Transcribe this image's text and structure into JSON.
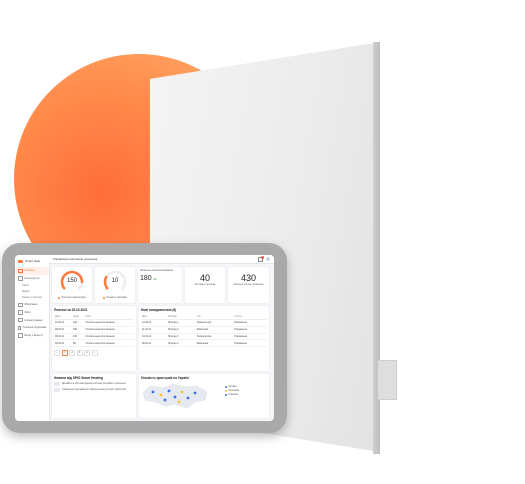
{
  "app": {
    "logo": "Smart Heat",
    "title": "Управління системою опалення"
  },
  "sidebar": {
    "items": [
      {
        "label": "Головна",
        "active": true
      },
      {
        "label": "Конструктор",
        "active": false
      },
      {
        "label": "Зберігання",
        "active": false
      },
      {
        "label": "Звіти",
        "active": false
      },
      {
        "label": "Налаштування",
        "active": false
      },
      {
        "label": "Технічна підтримка",
        "active": false
      },
      {
        "label": "Вихід з акаунту",
        "active": false
      }
    ],
    "subitems": [
      "Офіси",
      "Будівлі",
      "Кімнати і пристрої"
    ]
  },
  "header": {
    "notifications": "1"
  },
  "stats": {
    "gauge1": {
      "value": "150",
      "label": "Поточна температура",
      "color": "#ff7a3c"
    },
    "gauge2": {
      "value": "10",
      "label": "Кількість приладів",
      "color": "#ff7a3c"
    },
    "energy": {
      "label": "Загальне енергоспоживання",
      "value": "180",
      "unit": "кВт"
    },
    "count1": {
      "value": "40",
      "label": "Активних приладів"
    },
    "count2": {
      "value": "430",
      "label": "Загальна площа приміщень"
    }
  },
  "payments": {
    "title": "Платежі за 25.02.2021",
    "columns": [
      "Дата",
      "Сума",
      "Опис"
    ],
    "rows": [
      [
        "10.02.21",
        "120",
        "Оплата енергопостачання"
      ],
      [
        "09.02.21",
        "340",
        "Оплата енергопостачання"
      ],
      [
        "06.02.21",
        "210",
        "Оплата енергопостачання"
      ],
      [
        "03.02.21",
        "98",
        "Оплата енергопостачання"
      ]
    ],
    "pages": [
      "1",
      "2",
      "3",
      "4"
    ]
  },
  "notifications": {
    "title": "Нові повідомлення (6)",
    "columns": [
      "Дата",
      "Прилад",
      "Тип",
      "Статус"
    ],
    "rows": [
      [
        "12.02.21",
        "Прилад 1",
        "Температура",
        "Нормально"
      ],
      [
        "11.02.21",
        "Прилад 2",
        "Живлення",
        "Нормально"
      ],
      [
        "10.02.21",
        "Прилад 3",
        "Температура",
        "Нормально"
      ],
      [
        "08.02.21",
        "Прилад 4",
        "Живлення",
        "Нормально"
      ]
    ]
  },
  "news": {
    "title": "Новини від SPIO Smart Heating",
    "items": [
      "Дізнайтесь про нові функції системи розумного опалення",
      "Оновлення програмного забезпечення для всіх пристроїв"
    ]
  },
  "map": {
    "title": "Кількість пристроїв по Україні",
    "legend": [
      {
        "label": "Активні",
        "color": "#3d6fe0"
      },
      {
        "label": "Неактивні",
        "color": "#f5c32c"
      },
      {
        "label": "Помилка",
        "color": "#3d6fe0"
      }
    ]
  }
}
